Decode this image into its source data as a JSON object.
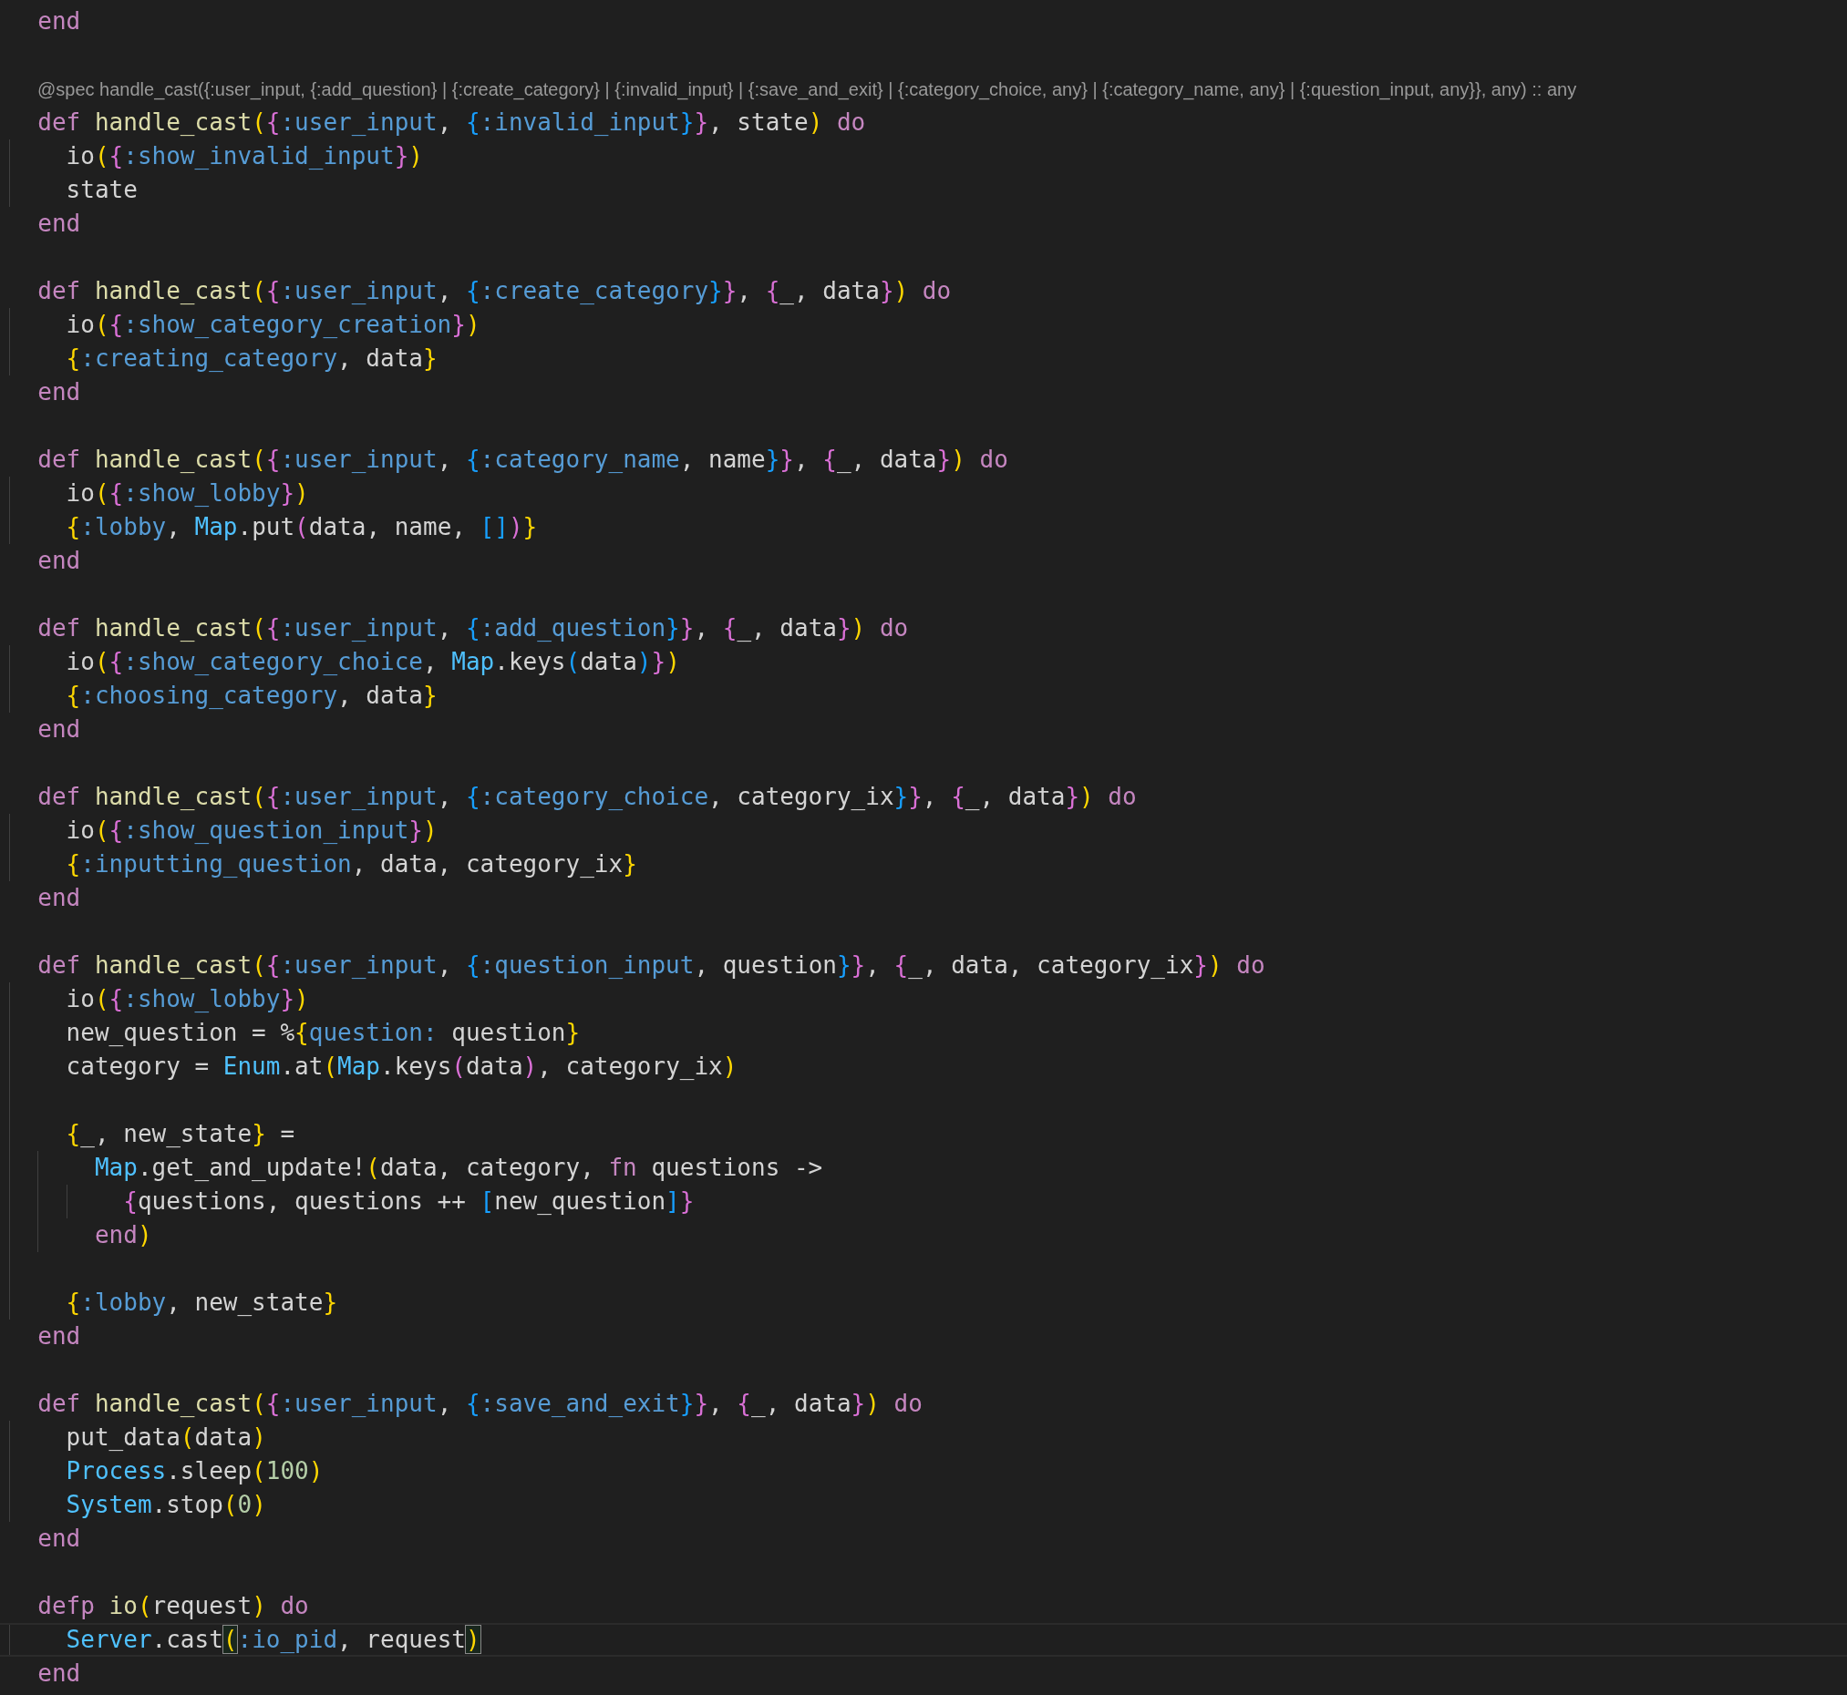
{
  "editor": {
    "lines": [
      {
        "kind": "code",
        "current": false,
        "tokens": [
          {
            "kind": "kw",
            "text": "  end"
          }
        ]
      },
      {
        "kind": "blank",
        "current": false
      },
      {
        "kind": "lens",
        "text": "@spec handle_cast({:user_input, {:add_question} | {:create_category} | {:invalid_input} | {:save_and_exit} | {:category_choice, any} | {:category_name, any} | {:question_input, any}}, any) :: any"
      },
      {
        "kind": "code",
        "current": false,
        "tokens": [
          {
            "kind": "kw",
            "text": "  def"
          },
          {
            "kind": "fn",
            "text": " handle_cast"
          },
          {
            "kind": "b1",
            "text": "("
          },
          {
            "kind": "b2",
            "text": "{"
          },
          {
            "kind": "atom",
            "text": ":user_input"
          },
          {
            "kind": "plain",
            "text": ","
          },
          {
            "kind": "b3",
            "text": " {"
          },
          {
            "kind": "atom",
            "text": ":invalid_input"
          },
          {
            "kind": "b3",
            "text": "}"
          },
          {
            "kind": "b2",
            "text": "}"
          },
          {
            "kind": "plain",
            "text": ", state"
          },
          {
            "kind": "b1",
            "text": ")"
          },
          {
            "kind": "kw",
            "text": " do"
          }
        ]
      },
      {
        "kind": "code",
        "current": false,
        "tokens": [
          {
            "kind": "plain",
            "text": "    io"
          },
          {
            "kind": "b1",
            "text": "("
          },
          {
            "kind": "b2",
            "text": "{"
          },
          {
            "kind": "atom",
            "text": ":show_invalid_input"
          },
          {
            "kind": "b2",
            "text": "}"
          },
          {
            "kind": "b1",
            "text": ")"
          }
        ]
      },
      {
        "kind": "code",
        "current": false,
        "tokens": [
          {
            "kind": "plain",
            "text": "    state"
          }
        ]
      },
      {
        "kind": "code",
        "current": false,
        "tokens": [
          {
            "kind": "kw",
            "text": "  end"
          }
        ]
      },
      {
        "kind": "blank",
        "current": false
      },
      {
        "kind": "code",
        "current": false,
        "tokens": [
          {
            "kind": "kw",
            "text": "  def"
          },
          {
            "kind": "fn",
            "text": " handle_cast"
          },
          {
            "kind": "b1",
            "text": "("
          },
          {
            "kind": "b2",
            "text": "{"
          },
          {
            "kind": "atom",
            "text": ":user_input"
          },
          {
            "kind": "plain",
            "text": ","
          },
          {
            "kind": "b3",
            "text": " {"
          },
          {
            "kind": "atom",
            "text": ":create_category"
          },
          {
            "kind": "b3",
            "text": "}"
          },
          {
            "kind": "b2",
            "text": "}"
          },
          {
            "kind": "plain",
            "text": ","
          },
          {
            "kind": "b2",
            "text": " {"
          },
          {
            "kind": "plain",
            "text": "_, data"
          },
          {
            "kind": "b2",
            "text": "}"
          },
          {
            "kind": "b1",
            "text": ")"
          },
          {
            "kind": "kw",
            "text": " do"
          }
        ]
      },
      {
        "kind": "code",
        "current": false,
        "tokens": [
          {
            "kind": "plain",
            "text": "    io"
          },
          {
            "kind": "b1",
            "text": "("
          },
          {
            "kind": "b2",
            "text": "{"
          },
          {
            "kind": "atom",
            "text": ":show_category_creation"
          },
          {
            "kind": "b2",
            "text": "}"
          },
          {
            "kind": "b1",
            "text": ")"
          }
        ]
      },
      {
        "kind": "code",
        "current": false,
        "tokens": [
          {
            "kind": "b1",
            "text": "    {"
          },
          {
            "kind": "atom",
            "text": ":creating_category"
          },
          {
            "kind": "plain",
            "text": ", data"
          },
          {
            "kind": "b1",
            "text": "}"
          }
        ]
      },
      {
        "kind": "code",
        "current": false,
        "tokens": [
          {
            "kind": "kw",
            "text": "  end"
          }
        ]
      },
      {
        "kind": "blank",
        "current": false
      },
      {
        "kind": "code",
        "current": false,
        "tokens": [
          {
            "kind": "kw",
            "text": "  def"
          },
          {
            "kind": "fn",
            "text": " handle_cast"
          },
          {
            "kind": "b1",
            "text": "("
          },
          {
            "kind": "b2",
            "text": "{"
          },
          {
            "kind": "atom",
            "text": ":user_input"
          },
          {
            "kind": "plain",
            "text": ","
          },
          {
            "kind": "b3",
            "text": " {"
          },
          {
            "kind": "atom",
            "text": ":category_name"
          },
          {
            "kind": "plain",
            "text": ", name"
          },
          {
            "kind": "b3",
            "text": "}"
          },
          {
            "kind": "b2",
            "text": "}"
          },
          {
            "kind": "plain",
            "text": ","
          },
          {
            "kind": "b2",
            "text": " {"
          },
          {
            "kind": "plain",
            "text": "_, data"
          },
          {
            "kind": "b2",
            "text": "}"
          },
          {
            "kind": "b1",
            "text": ")"
          },
          {
            "kind": "kw",
            "text": " do"
          }
        ]
      },
      {
        "kind": "code",
        "current": false,
        "tokens": [
          {
            "kind": "plain",
            "text": "    io"
          },
          {
            "kind": "b1",
            "text": "("
          },
          {
            "kind": "b2",
            "text": "{"
          },
          {
            "kind": "atom",
            "text": ":show_lobby"
          },
          {
            "kind": "b2",
            "text": "}"
          },
          {
            "kind": "b1",
            "text": ")"
          }
        ]
      },
      {
        "kind": "code",
        "current": false,
        "tokens": [
          {
            "kind": "b1",
            "text": "    {"
          },
          {
            "kind": "atom",
            "text": ":lobby"
          },
          {
            "kind": "plain",
            "text": ","
          },
          {
            "kind": "mod",
            "text": " Map"
          },
          {
            "kind": "plain",
            "text": ".put"
          },
          {
            "kind": "b2",
            "text": "("
          },
          {
            "kind": "plain",
            "text": "data, name,"
          },
          {
            "kind": "b3",
            "text": " ["
          },
          {
            "kind": "b3",
            "text": "]"
          },
          {
            "kind": "b2",
            "text": ")"
          },
          {
            "kind": "b1",
            "text": "}"
          }
        ]
      },
      {
        "kind": "code",
        "current": false,
        "tokens": [
          {
            "kind": "kw",
            "text": "  end"
          }
        ]
      },
      {
        "kind": "blank",
        "current": false
      },
      {
        "kind": "code",
        "current": false,
        "tokens": [
          {
            "kind": "kw",
            "text": "  def"
          },
          {
            "kind": "fn",
            "text": " handle_cast"
          },
          {
            "kind": "b1",
            "text": "("
          },
          {
            "kind": "b2",
            "text": "{"
          },
          {
            "kind": "atom",
            "text": ":user_input"
          },
          {
            "kind": "plain",
            "text": ","
          },
          {
            "kind": "b3",
            "text": " {"
          },
          {
            "kind": "atom",
            "text": ":add_question"
          },
          {
            "kind": "b3",
            "text": "}"
          },
          {
            "kind": "b2",
            "text": "}"
          },
          {
            "kind": "plain",
            "text": ","
          },
          {
            "kind": "b2",
            "text": " {"
          },
          {
            "kind": "plain",
            "text": "_, data"
          },
          {
            "kind": "b2",
            "text": "}"
          },
          {
            "kind": "b1",
            "text": ")"
          },
          {
            "kind": "kw",
            "text": " do"
          }
        ]
      },
      {
        "kind": "code",
        "current": false,
        "tokens": [
          {
            "kind": "plain",
            "text": "    io"
          },
          {
            "kind": "b1",
            "text": "("
          },
          {
            "kind": "b2",
            "text": "{"
          },
          {
            "kind": "atom",
            "text": ":show_category_choice"
          },
          {
            "kind": "plain",
            "text": ","
          },
          {
            "kind": "mod",
            "text": " Map"
          },
          {
            "kind": "plain",
            "text": ".keys"
          },
          {
            "kind": "b3",
            "text": "("
          },
          {
            "kind": "plain",
            "text": "data"
          },
          {
            "kind": "b3",
            "text": ")"
          },
          {
            "kind": "b2",
            "text": "}"
          },
          {
            "kind": "b1",
            "text": ")"
          }
        ]
      },
      {
        "kind": "code",
        "current": false,
        "tokens": [
          {
            "kind": "b1",
            "text": "    {"
          },
          {
            "kind": "atom",
            "text": ":choosing_category"
          },
          {
            "kind": "plain",
            "text": ", data"
          },
          {
            "kind": "b1",
            "text": "}"
          }
        ]
      },
      {
        "kind": "code",
        "current": false,
        "tokens": [
          {
            "kind": "kw",
            "text": "  end"
          }
        ]
      },
      {
        "kind": "blank",
        "current": false
      },
      {
        "kind": "code",
        "current": false,
        "tokens": [
          {
            "kind": "kw",
            "text": "  def"
          },
          {
            "kind": "fn",
            "text": " handle_cast"
          },
          {
            "kind": "b1",
            "text": "("
          },
          {
            "kind": "b2",
            "text": "{"
          },
          {
            "kind": "atom",
            "text": ":user_input"
          },
          {
            "kind": "plain",
            "text": ","
          },
          {
            "kind": "b3",
            "text": " {"
          },
          {
            "kind": "atom",
            "text": ":category_choice"
          },
          {
            "kind": "plain",
            "text": ", category_ix"
          },
          {
            "kind": "b3",
            "text": "}"
          },
          {
            "kind": "b2",
            "text": "}"
          },
          {
            "kind": "plain",
            "text": ","
          },
          {
            "kind": "b2",
            "text": " {"
          },
          {
            "kind": "plain",
            "text": "_, data"
          },
          {
            "kind": "b2",
            "text": "}"
          },
          {
            "kind": "b1",
            "text": ")"
          },
          {
            "kind": "kw",
            "text": " do"
          }
        ]
      },
      {
        "kind": "code",
        "current": false,
        "tokens": [
          {
            "kind": "plain",
            "text": "    io"
          },
          {
            "kind": "b1",
            "text": "("
          },
          {
            "kind": "b2",
            "text": "{"
          },
          {
            "kind": "atom",
            "text": ":show_question_input"
          },
          {
            "kind": "b2",
            "text": "}"
          },
          {
            "kind": "b1",
            "text": ")"
          }
        ]
      },
      {
        "kind": "code",
        "current": false,
        "tokens": [
          {
            "kind": "b1",
            "text": "    {"
          },
          {
            "kind": "atom",
            "text": ":inputting_question"
          },
          {
            "kind": "plain",
            "text": ", data, category_ix"
          },
          {
            "kind": "b1",
            "text": "}"
          }
        ]
      },
      {
        "kind": "code",
        "current": false,
        "tokens": [
          {
            "kind": "kw",
            "text": "  end"
          }
        ]
      },
      {
        "kind": "blank",
        "current": false
      },
      {
        "kind": "code",
        "current": false,
        "tokens": [
          {
            "kind": "kw",
            "text": "  def"
          },
          {
            "kind": "fn",
            "text": " handle_cast"
          },
          {
            "kind": "b1",
            "text": "("
          },
          {
            "kind": "b2",
            "text": "{"
          },
          {
            "kind": "atom",
            "text": ":user_input"
          },
          {
            "kind": "plain",
            "text": ","
          },
          {
            "kind": "b3",
            "text": " {"
          },
          {
            "kind": "atom",
            "text": ":question_input"
          },
          {
            "kind": "plain",
            "text": ", question"
          },
          {
            "kind": "b3",
            "text": "}"
          },
          {
            "kind": "b2",
            "text": "}"
          },
          {
            "kind": "plain",
            "text": ","
          },
          {
            "kind": "b2",
            "text": " {"
          },
          {
            "kind": "plain",
            "text": "_, data, category_ix"
          },
          {
            "kind": "b2",
            "text": "}"
          },
          {
            "kind": "b1",
            "text": ")"
          },
          {
            "kind": "kw",
            "text": " do"
          }
        ]
      },
      {
        "kind": "code",
        "current": false,
        "tokens": [
          {
            "kind": "plain",
            "text": "    io"
          },
          {
            "kind": "b1",
            "text": "("
          },
          {
            "kind": "b2",
            "text": "{"
          },
          {
            "kind": "atom",
            "text": ":show_lobby"
          },
          {
            "kind": "b2",
            "text": "}"
          },
          {
            "kind": "b1",
            "text": ")"
          }
        ]
      },
      {
        "kind": "code",
        "current": false,
        "tokens": [
          {
            "kind": "plain",
            "text": "    new_question = %"
          },
          {
            "kind": "b1",
            "text": "{"
          },
          {
            "kind": "atom",
            "text": "question:"
          },
          {
            "kind": "plain",
            "text": " question"
          },
          {
            "kind": "b1",
            "text": "}"
          }
        ]
      },
      {
        "kind": "code",
        "current": false,
        "tokens": [
          {
            "kind": "plain",
            "text": "    category ="
          },
          {
            "kind": "mod",
            "text": " Enum"
          },
          {
            "kind": "plain",
            "text": ".at"
          },
          {
            "kind": "b1",
            "text": "("
          },
          {
            "kind": "mod",
            "text": "Map"
          },
          {
            "kind": "plain",
            "text": ".keys"
          },
          {
            "kind": "b2",
            "text": "("
          },
          {
            "kind": "plain",
            "text": "data"
          },
          {
            "kind": "b2",
            "text": ")"
          },
          {
            "kind": "plain",
            "text": ", category_ix"
          },
          {
            "kind": "b1",
            "text": ")"
          }
        ]
      },
      {
        "kind": "blank",
        "current": false
      },
      {
        "kind": "code",
        "current": false,
        "tokens": [
          {
            "kind": "b1",
            "text": "    {"
          },
          {
            "kind": "plain",
            "text": "_, new_state"
          },
          {
            "kind": "b1",
            "text": "}"
          },
          {
            "kind": "plain",
            "text": " ="
          }
        ]
      },
      {
        "kind": "code",
        "current": false,
        "tokens": [
          {
            "kind": "mod",
            "text": "      Map"
          },
          {
            "kind": "plain",
            "text": ".get_and_update!"
          },
          {
            "kind": "b1",
            "text": "("
          },
          {
            "kind": "plain",
            "text": "data, category,"
          },
          {
            "kind": "kw",
            "text": " fn"
          },
          {
            "kind": "plain",
            "text": " questions ->"
          }
        ]
      },
      {
        "kind": "code",
        "current": false,
        "tokens": [
          {
            "kind": "b2",
            "text": "        {"
          },
          {
            "kind": "plain",
            "text": "questions, questions ++"
          },
          {
            "kind": "b3",
            "text": " ["
          },
          {
            "kind": "plain",
            "text": "new_question"
          },
          {
            "kind": "b3",
            "text": "]"
          },
          {
            "kind": "b2",
            "text": "}"
          }
        ]
      },
      {
        "kind": "code",
        "current": false,
        "tokens": [
          {
            "kind": "kw",
            "text": "      end"
          },
          {
            "kind": "b1",
            "text": ")"
          }
        ]
      },
      {
        "kind": "blank",
        "current": false
      },
      {
        "kind": "code",
        "current": false,
        "tokens": [
          {
            "kind": "b1",
            "text": "    {"
          },
          {
            "kind": "atom",
            "text": ":lobby"
          },
          {
            "kind": "plain",
            "text": ", new_state"
          },
          {
            "kind": "b1",
            "text": "}"
          }
        ]
      },
      {
        "kind": "code",
        "current": false,
        "tokens": [
          {
            "kind": "kw",
            "text": "  end"
          }
        ]
      },
      {
        "kind": "blank",
        "current": false
      },
      {
        "kind": "code",
        "current": false,
        "tokens": [
          {
            "kind": "kw",
            "text": "  def"
          },
          {
            "kind": "fn",
            "text": " handle_cast"
          },
          {
            "kind": "b1",
            "text": "("
          },
          {
            "kind": "b2",
            "text": "{"
          },
          {
            "kind": "atom",
            "text": ":user_input"
          },
          {
            "kind": "plain",
            "text": ","
          },
          {
            "kind": "b3",
            "text": " {"
          },
          {
            "kind": "atom",
            "text": ":save_and_exit"
          },
          {
            "kind": "b3",
            "text": "}"
          },
          {
            "kind": "b2",
            "text": "}"
          },
          {
            "kind": "plain",
            "text": ","
          },
          {
            "kind": "b2",
            "text": " {"
          },
          {
            "kind": "plain",
            "text": "_, data"
          },
          {
            "kind": "b2",
            "text": "}"
          },
          {
            "kind": "b1",
            "text": ")"
          },
          {
            "kind": "kw",
            "text": " do"
          }
        ]
      },
      {
        "kind": "code",
        "current": false,
        "tokens": [
          {
            "kind": "plain",
            "text": "    put_data"
          },
          {
            "kind": "b1",
            "text": "("
          },
          {
            "kind": "plain",
            "text": "data"
          },
          {
            "kind": "b1",
            "text": ")"
          }
        ]
      },
      {
        "kind": "code",
        "current": false,
        "tokens": [
          {
            "kind": "mod",
            "text": "    Process"
          },
          {
            "kind": "plain",
            "text": ".sleep"
          },
          {
            "kind": "b1",
            "text": "("
          },
          {
            "kind": "num",
            "text": "100"
          },
          {
            "kind": "b1",
            "text": ")"
          }
        ]
      },
      {
        "kind": "code",
        "current": false,
        "tokens": [
          {
            "kind": "mod",
            "text": "    System"
          },
          {
            "kind": "plain",
            "text": ".stop"
          },
          {
            "kind": "b1",
            "text": "("
          },
          {
            "kind": "num",
            "text": "0"
          },
          {
            "kind": "b1",
            "text": ")"
          }
        ]
      },
      {
        "kind": "code",
        "current": false,
        "tokens": [
          {
            "kind": "kw",
            "text": "  end"
          }
        ]
      },
      {
        "kind": "blank",
        "current": false
      },
      {
        "kind": "code",
        "current": false,
        "tokens": [
          {
            "kind": "kw",
            "text": "  defp"
          },
          {
            "kind": "fn",
            "text": " io"
          },
          {
            "kind": "b1",
            "text": "("
          },
          {
            "kind": "plain",
            "text": "request"
          },
          {
            "kind": "b1",
            "text": ")"
          },
          {
            "kind": "kw",
            "text": " do"
          }
        ]
      },
      {
        "kind": "code",
        "current": true,
        "tokens": [
          {
            "kind": "mod",
            "text": "    Server"
          },
          {
            "kind": "plain",
            "text": ".cast"
          },
          {
            "kind": "b1",
            "text": "(",
            "matched": true
          },
          {
            "kind": "atom",
            "text": ":io_pid"
          },
          {
            "kind": "plain",
            "text": ", request"
          },
          {
            "kind": "b1",
            "text": ")",
            "matched": true
          }
        ]
      },
      {
        "kind": "code",
        "current": false,
        "tokens": [
          {
            "kind": "kw",
            "text": "  end"
          }
        ]
      }
    ]
  }
}
